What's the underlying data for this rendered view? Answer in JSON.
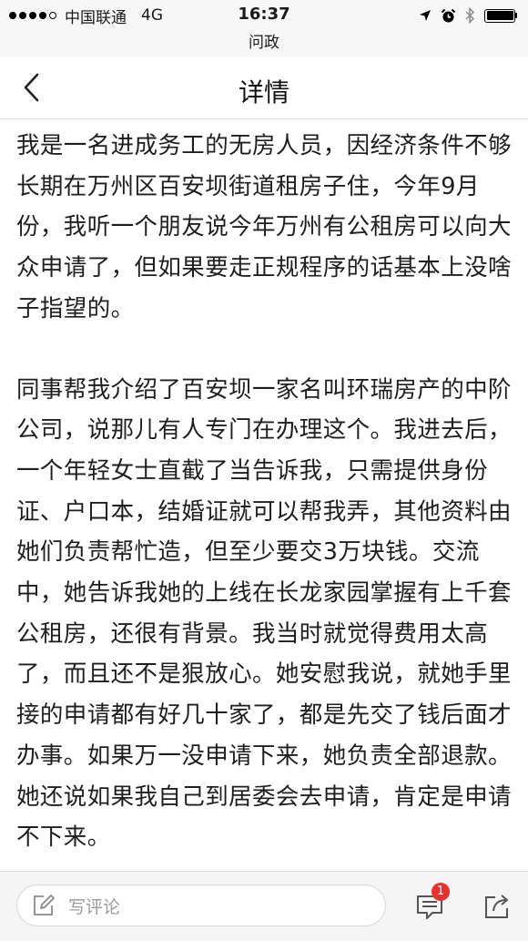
{
  "status_bar": {
    "carrier": "中国联通",
    "network": "4G",
    "time": "16:37",
    "app_name": "问政",
    "icons": [
      "signal-dots-icon",
      "location-arrow-icon",
      "alarm-clock-icon",
      "bluetooth-icon",
      "battery-icon"
    ]
  },
  "nav": {
    "title": "详情",
    "back_icon": "chevron-left-icon"
  },
  "article": {
    "paragraphs": [
      "我是一名进成务工的无房人员，因经济条件不够长期在万州区百安坝街道租房子住，今年9月份，我听一个朋友说今年万州有公租房可以向大众申请了，但如果要走正规程序的话基本上没啥子指望的。",
      "同事帮我介绍了百安坝一家名叫环瑞房产的中阶公司，说那儿有人专门在办理这个。我进去后，一个年轻女士直截了当告诉我，只需提供身份证、户口本，结婚证就可以帮我弄，其他资料由她们负责帮忙造，但至少要交3万块钱。交流中，她告诉我她的上线在长龙家园掌握有上千套公租房，还很有背景。我当时就觉得费用太高了，而且还不是狠放心。她安慰我说，就她手里接的申请都有好几十家了，都是先交了钱后面才办事。如果万一没申请下来，她负责全部退款。她还说如果我自己到居委会去申请，肯定是申请不下来。"
    ]
  },
  "bottom_bar": {
    "comment_placeholder": "写评论",
    "comment_count": "1",
    "icons": [
      "pencil-square-icon",
      "comment-bubble-icon",
      "share-icon"
    ],
    "badge_color": "#e8312f"
  }
}
